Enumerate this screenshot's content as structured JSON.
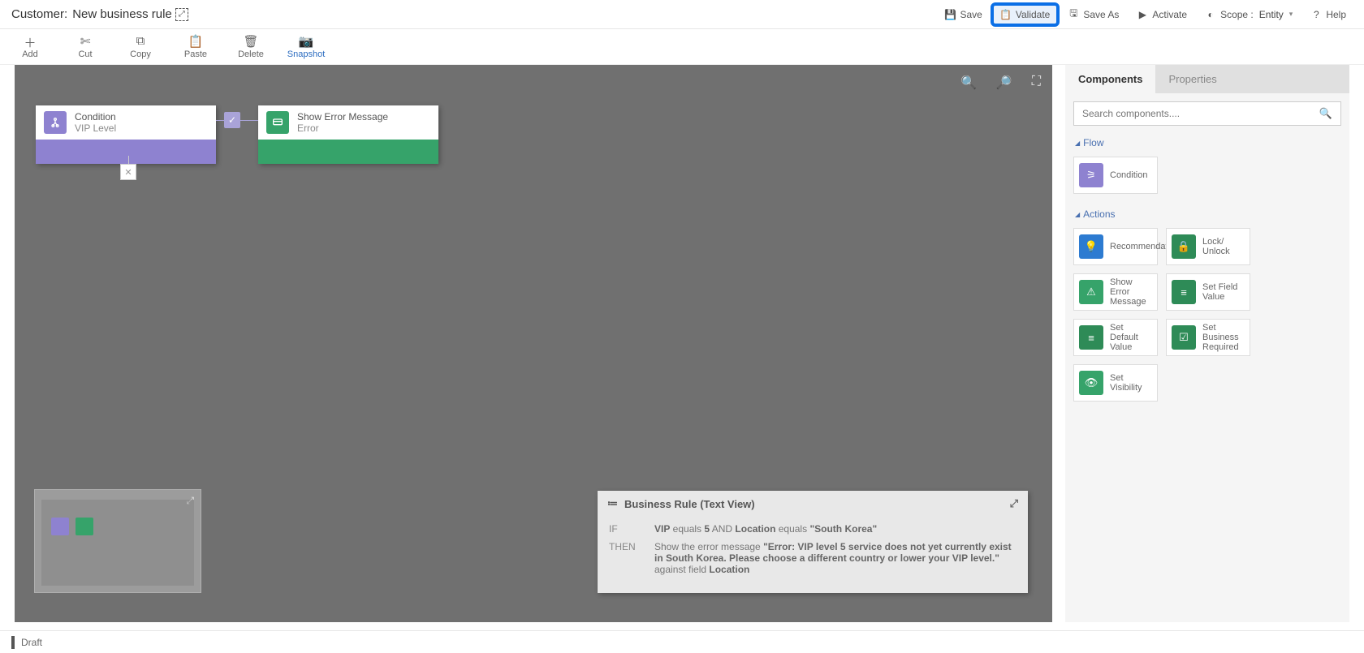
{
  "header": {
    "title_prefix": "Customer:",
    "title_name": "New business rule",
    "buttons": {
      "save": "Save",
      "validate": "Validate",
      "save_as": "Save As",
      "activate": "Activate",
      "scope_label": "Scope :",
      "scope_value": "Entity",
      "help": "Help"
    }
  },
  "toolbar": {
    "add": "Add",
    "cut": "Cut",
    "copy": "Copy",
    "paste": "Paste",
    "delete": "Delete",
    "snapshot": "Snapshot"
  },
  "canvas": {
    "condition": {
      "title": "Condition",
      "subtitle": "VIP Level"
    },
    "action": {
      "title": "Show Error Message",
      "subtitle": "Error"
    },
    "stub": "✕",
    "check": "✓"
  },
  "textview": {
    "title": "Business Rule (Text View)",
    "if": "IF",
    "then": "THEN",
    "if_html": "<b>VIP</b> equals <b>5</b> AND <b>Location</b> equals <b>\"South Korea\"</b>",
    "then_html": "Show the error message <b>\"Error: VIP level 5 service does not yet currently exist in South Korea. Please choose a different country or lower your VIP level.\"</b> against field <b>Location</b>"
  },
  "side": {
    "tabs": {
      "components": "Components",
      "properties": "Properties"
    },
    "search_placeholder": "Search components....",
    "sections": {
      "flow": "Flow",
      "actions": "Actions"
    },
    "components": {
      "condition": "Condition",
      "recommendation": "Recommendation",
      "lock": "Lock/ Unlock",
      "show_error": "Show Error Message",
      "set_field": "Set Field Value",
      "set_default": "Set Default Value",
      "set_required": "Set Business Required",
      "set_visibility": "Set Visibility"
    }
  },
  "status": {
    "text": "Draft"
  }
}
